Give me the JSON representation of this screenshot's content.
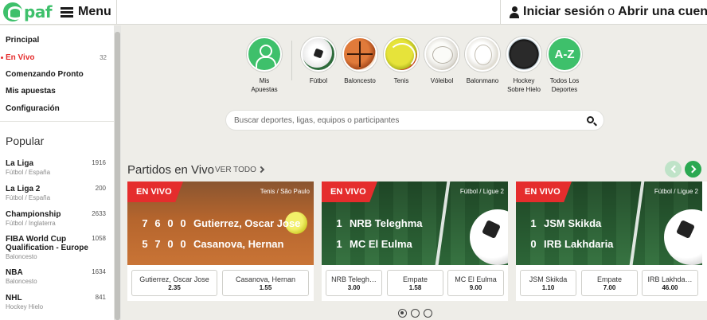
{
  "header": {
    "logo_text": "paf",
    "menu_label": "Menu",
    "login_label": "Iniciar sesión",
    "or_text": "o",
    "register_label": "Abrir una cuenta"
  },
  "sidebar": {
    "nav": [
      {
        "label": "Principal"
      },
      {
        "label": "En Vivo",
        "count": "32"
      },
      {
        "label": "Comenzando Pronto"
      },
      {
        "label": "Mis apuestas"
      },
      {
        "label": "Configuración"
      }
    ],
    "popular_title": "Popular",
    "leagues": [
      {
        "name": "La Liga",
        "sub": "Fútbol / España",
        "count": "1916"
      },
      {
        "name": "La Liga 2",
        "sub": "Fútbol / España",
        "count": "200"
      },
      {
        "name": "Championship",
        "sub": "Fútbol / Inglaterra",
        "count": "2633"
      },
      {
        "name": "FIBA World Cup Qualification - Europe",
        "sub": "Baloncesto",
        "count": "1058"
      },
      {
        "name": "NBA",
        "sub": "Baloncesto",
        "count": "1634"
      },
      {
        "name": "NHL",
        "sub": "Hockey Hielo",
        "count": "841"
      }
    ]
  },
  "sports": [
    {
      "label": "Mis Apuestas",
      "icon": "user-icon"
    },
    {
      "label": "Fútbol",
      "icon": "football-icon"
    },
    {
      "label": "Baloncesto",
      "icon": "basketball-icon"
    },
    {
      "label": "Tenis",
      "icon": "tennis-ball-icon"
    },
    {
      "label": "Vóleibol",
      "icon": "volleyball-icon"
    },
    {
      "label": "Balonmano",
      "icon": "handball-icon"
    },
    {
      "label": "Hockey Sobre Hielo",
      "icon": "hockey-puck-icon"
    },
    {
      "label": "Todos Los Deportes",
      "icon": "a-z-icon",
      "text": "A-Z"
    }
  ],
  "search": {
    "placeholder": "Buscar deportes, ligas, equipos o participantes"
  },
  "live_section": {
    "title": "Partidos en Vivo",
    "see_all": "VER TODO"
  },
  "live_badge": "EN VIVO",
  "cards": [
    {
      "competition": "Tenis / São Paulo",
      "teams": [
        {
          "scores": [
            "7",
            "6",
            "0",
            "0"
          ],
          "name": "Gutierrez, Oscar Jose"
        },
        {
          "scores": [
            "5",
            "7",
            "0",
            "0"
          ],
          "name": "Casanova, Hernan"
        }
      ],
      "odds": [
        {
          "label": "Gutierrez, Oscar Jose",
          "value": "2.35"
        },
        {
          "label": "Casanova, Hernan",
          "value": "1.55"
        }
      ]
    },
    {
      "competition": "Fútbol / Ligue 2",
      "teams": [
        {
          "scores": [
            "1"
          ],
          "name": "NRB Teleghma"
        },
        {
          "scores": [
            "1"
          ],
          "name": "MC El Eulma"
        }
      ],
      "odds": [
        {
          "label": "NRB Telegh…",
          "value": "3.00"
        },
        {
          "label": "Empate",
          "value": "1.58"
        },
        {
          "label": "MC El Eulma",
          "value": "9.00"
        }
      ]
    },
    {
      "competition": "Fútbol / Ligue 2",
      "teams": [
        {
          "scores": [
            "1"
          ],
          "name": "JSM Skikda"
        },
        {
          "scores": [
            "0"
          ],
          "name": "IRB Lakhdaria"
        }
      ],
      "odds": [
        {
          "label": "JSM Skikda",
          "value": "1.10"
        },
        {
          "label": "Empate",
          "value": "7.00"
        },
        {
          "label": "IRB Lakhda…",
          "value": "46.00"
        }
      ]
    }
  ],
  "colors": {
    "brand_green": "#3ec06b",
    "live_red": "#e52d2d",
    "background": "#eeede8"
  }
}
